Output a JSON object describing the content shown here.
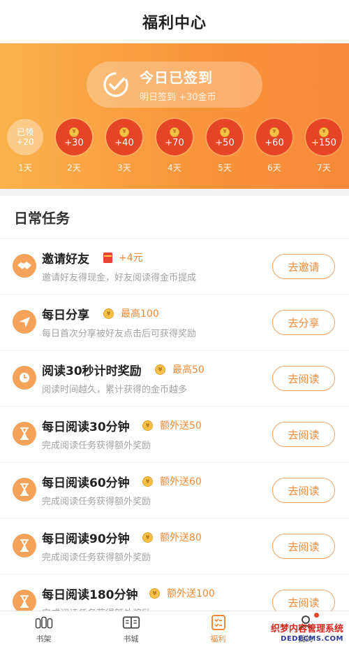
{
  "header": {
    "title": "福利中心"
  },
  "signin": {
    "status": "今日已签到",
    "tomorrow": "明日签到 +30金币",
    "days": [
      {
        "label": "1天",
        "amount": "+20",
        "signed": true,
        "signed_text": "已领"
      },
      {
        "label": "2天",
        "amount": "+30",
        "signed": false
      },
      {
        "label": "3天",
        "amount": "+40",
        "signed": false
      },
      {
        "label": "4天",
        "amount": "+70",
        "signed": false
      },
      {
        "label": "5天",
        "amount": "+50",
        "signed": false
      },
      {
        "label": "6天",
        "amount": "+60",
        "signed": false
      },
      {
        "label": "7天",
        "amount": "+150",
        "signed": false
      }
    ]
  },
  "tasks": {
    "section_title": "日常任务",
    "items": [
      {
        "icon": "handshake-icon",
        "title": "邀请好友",
        "reward_type": "redpacket",
        "reward": "+4元",
        "desc": "邀请好友得现金，好友阅读得金币提成",
        "button": "去邀请"
      },
      {
        "icon": "paper-plane-icon",
        "title": "每日分享",
        "reward_type": "coin",
        "reward": "最高100",
        "desc": "每日首次分享被好友点击后可获得奖励",
        "button": "去分享"
      },
      {
        "icon": "clock-icon",
        "title": "阅读30秒计时奖励",
        "reward_type": "coin",
        "reward": "最高50",
        "desc": "阅读时间越久，累计获得的金币越多",
        "button": "去阅读"
      },
      {
        "icon": "hourglass-icon",
        "title": "每日阅读30分钟",
        "reward_type": "coin",
        "reward": "额外送50",
        "desc": "完成阅读任务获得额外奖励",
        "button": "去阅读"
      },
      {
        "icon": "hourglass-icon",
        "title": "每日阅读60分钟",
        "reward_type": "coin",
        "reward": "额外送60",
        "desc": "完成阅读任务获得额外奖励",
        "button": "去阅读"
      },
      {
        "icon": "hourglass-icon",
        "title": "每日阅读90分钟",
        "reward_type": "coin",
        "reward": "额外送80",
        "desc": "完成阅读任务获得额外奖励",
        "button": "去阅读"
      },
      {
        "icon": "hourglass-icon",
        "title": "每日阅读180分钟",
        "reward_type": "coin",
        "reward": "额外送100",
        "desc": "完成阅读任务获得额外奖励",
        "button": "去阅读"
      }
    ]
  },
  "tabbar": {
    "items": [
      {
        "label": "书架",
        "icon": "bookshelf-icon",
        "active": false
      },
      {
        "label": "书城",
        "icon": "book-icon",
        "active": false
      },
      {
        "label": "福利",
        "icon": "checklist-icon",
        "active": true
      },
      {
        "label": "我的",
        "icon": "user-icon",
        "active": false,
        "badge": true
      }
    ]
  },
  "watermark": {
    "line1": "织梦内容管理系统",
    "line2": "DEDECMS.COM"
  },
  "colors": {
    "accent": "#f08a35",
    "banner_start": "#fbb24d",
    "banner_end": "#f7893a",
    "coin_red": "#e54427"
  }
}
